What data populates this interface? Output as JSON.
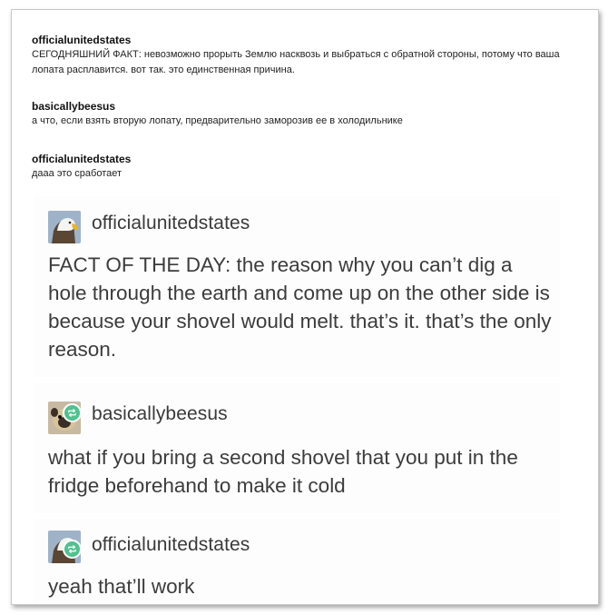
{
  "translation": [
    {
      "user": "officialunitedstates",
      "text": "СЕГОДНЯШНИЙ ФАКТ: невозможно прорыть Землю насквозь и выбраться с обратной стороны, потому что ваша лопата расплавится. вот так. это единственная причина."
    },
    {
      "user": "basicallybeesus",
      "text": "а что, если взять вторую лопату, предварительно заморозив ее в холодильнике"
    },
    {
      "user": "officialunitedstates",
      "text": "дааа это сработает"
    }
  ],
  "posts": [
    {
      "user": "officialunitedstates",
      "avatar_icon": "eagle-avatar-icon",
      "reblogged": false,
      "text": "FACT OF THE DAY: the reason why you can’t dig a hole through the earth and come up on the other side is because your shovel would melt. that’s it. that’s the only reason."
    },
    {
      "user": "basicallybeesus",
      "avatar_icon": "pug-avatar-icon",
      "reblogged": true,
      "text": "what if you bring a second shovel that you put in the fridge beforehand to make it cold"
    },
    {
      "user": "officialunitedstates",
      "avatar_icon": "eagle-avatar-icon",
      "reblogged": true,
      "text": "yeah that’ll work"
    }
  ],
  "colors": {
    "reblog_badge": "#4fc28f",
    "panel_bg": "#fdfdfd",
    "text": "#3c3c3c"
  }
}
